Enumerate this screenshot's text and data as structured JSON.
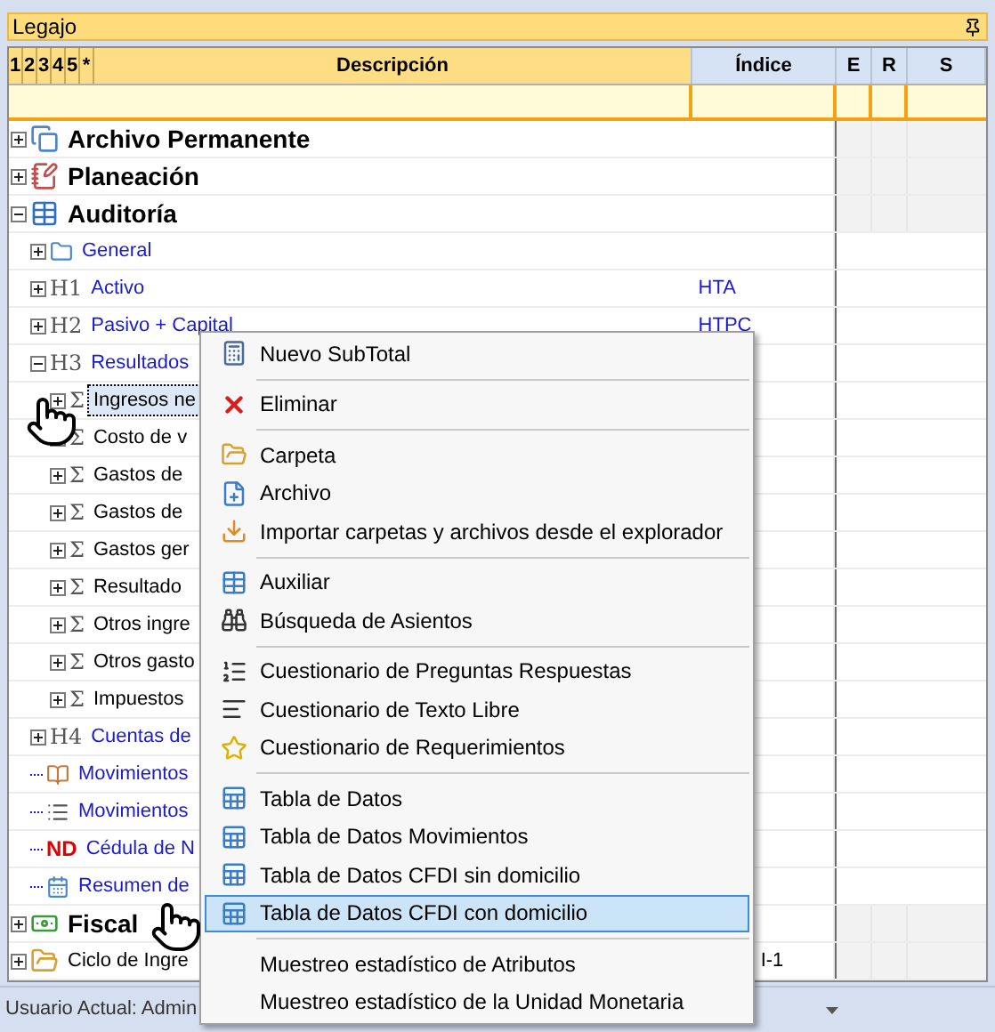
{
  "panel": {
    "title": "Legajo"
  },
  "levels": [
    "1",
    "2",
    "3",
    "4",
    "5",
    "*"
  ],
  "columns": [
    {
      "label": "Descripción",
      "kind": "main"
    },
    {
      "label": "Índice",
      "kind": "side"
    },
    {
      "label": "E",
      "kind": "side"
    },
    {
      "label": "R",
      "kind": "side"
    },
    {
      "label": "S",
      "kind": "side"
    }
  ],
  "tree": [
    {
      "label": "Archivo Permanente",
      "kind": "node",
      "expanded": false,
      "bold": true
    },
    {
      "label": "Planeación",
      "kind": "node",
      "expanded": false,
      "bold": true
    },
    {
      "label": "Auditoría",
      "kind": "node",
      "expanded": true,
      "bold": true,
      "children": [
        {
          "label": "General",
          "kind": "node",
          "expanded": false
        },
        {
          "prefix": "H1",
          "label": "Activo",
          "index": "HTA",
          "kind": "node",
          "expanded": false
        },
        {
          "prefix": "H2",
          "label": "Pasivo + Capital",
          "index": "HTPC",
          "kind": "node",
          "expanded": false
        },
        {
          "prefix": "H3",
          "label": "Resultados",
          "kind": "node",
          "expanded": true,
          "children": [
            {
              "prefix": "Σ",
              "label": "Ingresos ne",
              "kind": "node",
              "expanded": false,
              "selected": true
            },
            {
              "prefix": "Σ",
              "label": "Costo de v",
              "kind": "node",
              "expanded": false,
              "selected": false
            },
            {
              "prefix": "Σ",
              "label": "Gastos de",
              "kind": "node",
              "expanded": false,
              "selected": false
            },
            {
              "prefix": "Σ",
              "label": "Gastos de",
              "kind": "node",
              "expanded": false,
              "selected": false
            },
            {
              "prefix": "Σ",
              "label": "Gastos ger",
              "kind": "node",
              "expanded": false,
              "selected": false
            },
            {
              "prefix": "Σ",
              "label": "Resultado",
              "kind": "node",
              "expanded": false,
              "selected": false
            },
            {
              "prefix": "Σ",
              "label": "Otros ingre",
              "kind": "node",
              "expanded": false,
              "selected": false
            },
            {
              "prefix": "Σ",
              "label": "Otros gasto",
              "kind": "node",
              "expanded": false,
              "selected": false
            },
            {
              "prefix": "Σ",
              "label": "Impuestos",
              "kind": "node",
              "expanded": false,
              "selected": false
            }
          ]
        },
        {
          "prefix": "H4",
          "label": "Cuentas de",
          "kind": "node",
          "expanded": false
        },
        {
          "label": "Movimientos",
          "kind": "leaf"
        },
        {
          "label": "Movimientos",
          "kind": "leaf"
        },
        {
          "prefix": "ND",
          "label": "Cédula de N",
          "kind": "leaf"
        },
        {
          "label": "Resumen de",
          "kind": "leaf"
        }
      ]
    },
    {
      "label": "Fiscal",
      "kind": "node",
      "expanded": false,
      "bold": true
    },
    {
      "label": "Ciclo de Ingre",
      "index": "I-1",
      "index_cut": true,
      "kind": "node",
      "expanded": false,
      "bold": false
    }
  ],
  "context_menu": [
    [
      {
        "label": "Nuevo SubTotal",
        "selected": false
      }
    ],
    [
      {
        "label": "Eliminar",
        "selected": false
      }
    ],
    [
      {
        "label": "Carpeta",
        "selected": false
      },
      {
        "label": "Archivo",
        "selected": false
      },
      {
        "label": "Importar carpetas y archivos desde el explorador",
        "selected": false
      }
    ],
    [
      {
        "label": "Auxiliar",
        "selected": false
      },
      {
        "label": "Búsqueda de Asientos",
        "selected": false
      }
    ],
    [
      {
        "label": "Cuestionario de Preguntas Respuestas",
        "selected": false
      },
      {
        "label": "Cuestionario de Texto Libre",
        "selected": false
      },
      {
        "label": "Cuestionario de Requerimientos",
        "selected": false
      }
    ],
    [
      {
        "label": "Tabla de Datos",
        "selected": false
      },
      {
        "label": "Tabla de Datos Movimientos",
        "selected": false
      },
      {
        "label": "Tabla de Datos CFDI sin domicilio",
        "selected": false
      },
      {
        "label": "Tabla de Datos CFDI con domicilio",
        "selected": true
      }
    ],
    [
      {
        "label": "Muestreo estadístico de Atributos",
        "selected": false
      },
      {
        "label": "Muestreo estadístico de la Unidad Monetaria",
        "selected": false
      }
    ]
  ],
  "status_bar": {
    "user": "Usuario Actual: Admin"
  }
}
